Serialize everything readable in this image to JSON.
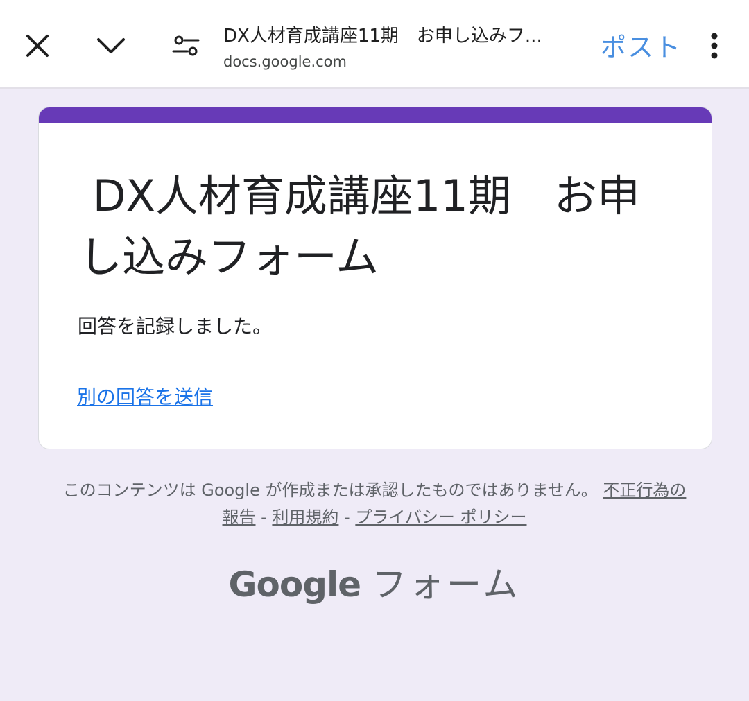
{
  "browser": {
    "title": "DX人材育成講座11期　お申し込みフ...",
    "url": "docs.google.com",
    "post_label": "ポスト",
    "icons": {
      "close": "close-icon",
      "chevron": "chevron-down-icon",
      "settings": "page-settings-icon",
      "more": "more-vert-icon"
    }
  },
  "form": {
    "title": " DX人材育成講座11期　お申し込みフォーム",
    "confirmation": "回答を記録しました。",
    "another_response_link": "別の回答を送信",
    "accent_color": "#673ab7"
  },
  "footer": {
    "disclaimer_text": "このコンテンツは Google が作成または承認したものではありません。",
    "report_link": "不正行為の報告",
    "separator": " - ",
    "terms_link": "利用規約",
    "privacy_link": "プライバシー ポリシー"
  },
  "brand": {
    "google": "Google",
    "forms": "フォーム"
  }
}
